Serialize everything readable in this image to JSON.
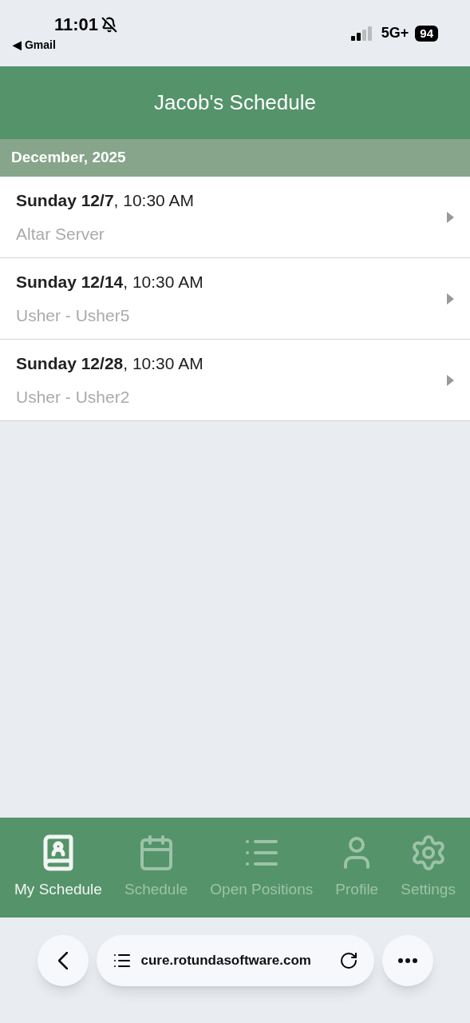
{
  "status_bar": {
    "time": "11:01",
    "back_app": "◀ Gmail",
    "network": "5G+",
    "battery": "94"
  },
  "header": {
    "title": "Jacob's Schedule"
  },
  "month": "December, 2025",
  "events": [
    {
      "day": "Sunday 12/7",
      "time": ", 10:30 AM",
      "role": "Altar Server"
    },
    {
      "day": "Sunday 12/14",
      "time": ", 10:30 AM",
      "role": "Usher - Usher5"
    },
    {
      "day": "Sunday 12/28",
      "time": ", 10:30 AM",
      "role": "Usher - Usher2"
    }
  ],
  "nav": [
    {
      "label": "My Schedule",
      "kind": "contacts",
      "selected": true
    },
    {
      "label": "Schedule",
      "kind": "calendar",
      "selected": false
    },
    {
      "label": "Open Positions",
      "kind": "list",
      "selected": false
    },
    {
      "label": "Profile",
      "kind": "profile",
      "selected": false
    },
    {
      "label": "Settings",
      "kind": "settings",
      "selected": false
    }
  ],
  "browser": {
    "url": "cure.rotundasoftware.com"
  }
}
